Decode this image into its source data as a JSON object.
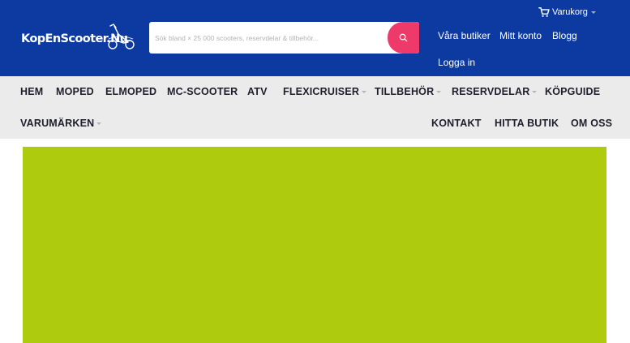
{
  "header": {
    "logo_text": "KopEnScooter.Nu",
    "search": {
      "placeholder": "Sök bland × 25 000 scooters, reservdelar & tillbehör..."
    },
    "cart_label": "Varukorg",
    "links": [
      "Våra butiker",
      "Mitt konto",
      "Blogg",
      "Logga in"
    ]
  },
  "nav": {
    "items": [
      {
        "label": "HEM",
        "dropdown": false
      },
      {
        "label": "MOPED",
        "dropdown": false
      },
      {
        "label": "ELMOPED",
        "dropdown": false
      },
      {
        "label": "MC-SCOOTER",
        "dropdown": false
      },
      {
        "label": "ATV",
        "dropdown": false
      },
      {
        "label": "FLEXICRUISER",
        "dropdown": true
      },
      {
        "label": "TILLBEHÖR",
        "dropdown": true
      },
      {
        "label": "RESERVDELAR",
        "dropdown": true
      },
      {
        "label": "KÖPGUIDE",
        "dropdown": false
      },
      {
        "label": "VARUMÄRKEN",
        "dropdown": true
      },
      {
        "label": "KONTAKT",
        "dropdown": false
      },
      {
        "label": "HITTA BUTIK",
        "dropdown": false
      },
      {
        "label": "OM OSS",
        "dropdown": false
      }
    ]
  },
  "icons": {
    "search": "search-icon",
    "cart": "cart-icon",
    "logo": "scooter-logo-icon"
  },
  "colors": {
    "header_bg": "#0c3aa1",
    "search_button": "#ee3a6a",
    "nav_bg": "#ebebeb",
    "banner": "#afcb0d"
  }
}
